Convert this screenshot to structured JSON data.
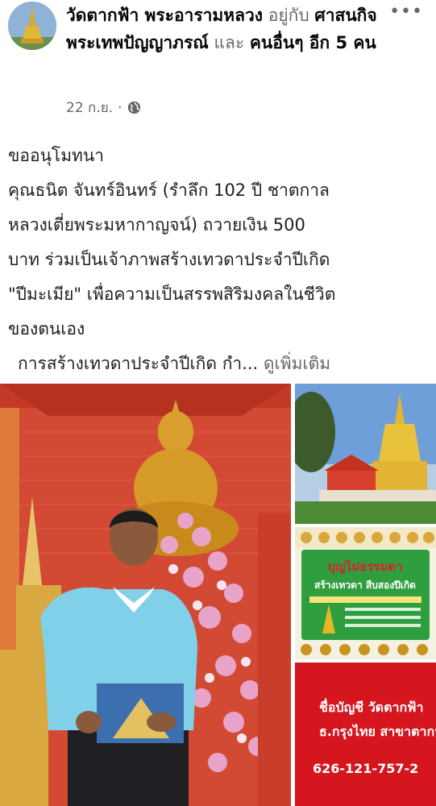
{
  "header": {
    "page_name": "วัดตากฟ้า พระอารามหลวง",
    "with_text": "อยู่กับ",
    "tagged_person": "ศาสนกิจ พระเทพปัญญาภรณ์",
    "and_text": "และ",
    "others_text": "คนอื่นๆ อีก 5 คน",
    "timestamp": "22 ก.ย.",
    "separator": "·",
    "audience_icon": "globe-icon",
    "more_label": "•••"
  },
  "post": {
    "lines": [
      "ขออนุโมทนา",
      "คุณธนิต จันทร์อินทร์ (รำลึก 102 ปี ชาตกาล",
      "หลวงเตี่ยพระมหากาญจน์) ถวายเงิน 500",
      "บาท ร่วมเป็นเจ้าภาพสร้างเทวดาประจำปีเกิด",
      "\"ปีมะเมีย\" เพื่อความเป็นสรรพสิริมงคลในชีวิต",
      "ของตนเอง"
    ],
    "truncated_line": "การสร้างเทวดาประจำปีเกิด กำ...",
    "see_more": "ดูเพิ่มเติม"
  },
  "photos": {
    "poster_title": "บุญไม่ธรรมดา",
    "poster_subtitle": "สร้างเทวดา สืบสองปีเกิด",
    "bank_account_label": "ชื่อบัญชี วัดตากฟ้า",
    "bank_branch_label": "ธ.กรุงไทย สาขาตากฟ้",
    "bank_account_number": "626-121-757-2"
  },
  "colors": {
    "text_primary": "#1c1e21",
    "text_muted": "#65676b",
    "bank_card_red": "#d6161f",
    "poster_green": "#2e9e3f",
    "wall_red": "#d8462f"
  }
}
